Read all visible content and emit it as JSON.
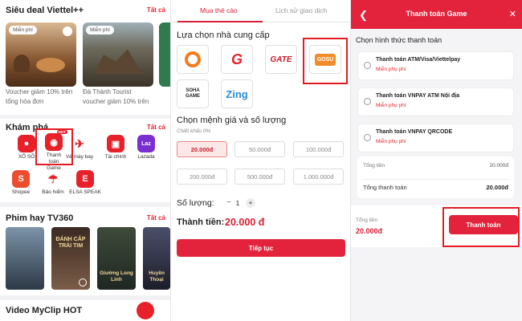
{
  "panel1": {
    "deals": {
      "title": "Siêu deal Viettel++",
      "see_all": "Tất cả",
      "items": [
        {
          "tag": "Miễn phí",
          "line1": "Voucher giảm 10% trên",
          "line2": "tổng hóa đơn"
        },
        {
          "tag": "Miễn phí",
          "line1": "Đà Thành Tourist",
          "line2": "voucher giảm 10% trên"
        }
      ]
    },
    "explore": {
      "title": "Khám phá",
      "see_all": "Tất cả",
      "apps": [
        {
          "label": "XỔ SỐ",
          "icon": "lottery-icon",
          "color": "#e8202a"
        },
        {
          "label": "Thanh toán Game",
          "icon": "gamepad-icon",
          "color": "#e8202a",
          "badge": "HOT"
        },
        {
          "label": "Vé máy bay",
          "icon": "plane-icon",
          "color": "#e8202a"
        },
        {
          "label": "Tài chính",
          "icon": "wallet-icon",
          "color": "#e8202a"
        },
        {
          "label": "Lazada",
          "icon": "lazada-icon",
          "color": "#7b2fd0"
        },
        {
          "label": "Shopee",
          "icon": "shopee-icon",
          "color": "#ee4d2d"
        },
        {
          "label": "Bảo hiểm",
          "icon": "umbrella-icon",
          "color": "#e8202a"
        },
        {
          "label": "ELSA SPEAK",
          "icon": "elsa-icon",
          "color": "#e8202a"
        }
      ]
    },
    "movies": {
      "title": "Phim hay TV360",
      "see_all": "Tất cả",
      "posters": [
        {
          "text": ""
        },
        {
          "text": "ĐÁNH CẮP TRÁI TIM"
        },
        {
          "text": "Giường Long Linh"
        },
        {
          "text": "Huyền Thoại"
        }
      ]
    },
    "clips": {
      "title": "Video MyClip HOT"
    }
  },
  "panel2": {
    "tabs": [
      "Mua thẻ cào",
      "Lịch sử giao dịch"
    ],
    "provider_title": "Lựa chọn nhà cung cấp",
    "providers": [
      {
        "name": "Funtap",
        "label": "funtap"
      },
      {
        "name": "Garena",
        "label": "G"
      },
      {
        "name": "Gate",
        "label": "GATE"
      },
      {
        "name": "Gosu",
        "label": "GOSU"
      },
      {
        "name": "Soha Game",
        "label": "SOHA GAME"
      },
      {
        "name": "Zing",
        "label": "Zing"
      }
    ],
    "price_title": "Chọn mệnh giá và số lượng",
    "discount": "Chiết khấu 0%",
    "prices": [
      "20.000đ",
      "50.000đ",
      "100.000đ",
      "200.000đ",
      "500.000đ",
      "1.000.000đ"
    ],
    "quantity_label": "Số lượng:",
    "quantity": "1",
    "minus": "−",
    "plus": "+",
    "total_label": "Thành tiền:",
    "total_value": "20.000 đ",
    "continue_label": "Tiếp tục"
  },
  "panel3": {
    "title": "Thanh toán Game",
    "back": "❮",
    "close": "✕",
    "method_title": "Chọn hình thức thanh toán",
    "methods": [
      {
        "name": "Thanh toán ATM/Visa/Viettelpay",
        "fee": "Miễn phụ phí"
      },
      {
        "name": "Thanh toán VNPAY ATM Nội địa",
        "fee": "Miễn phụ phí"
      },
      {
        "name": "Thanh toán VNPAY QRCODE",
        "fee": "Miễn phụ phí"
      }
    ],
    "subtotal_label": "Tổng tiền",
    "subtotal_value": "20.000đ",
    "total_label": "Tổng thanh toán",
    "total_value": "20.000đ",
    "footer_label": "Tổng tiền",
    "footer_value": "20.000đ",
    "pay_label": "Thanh toán"
  },
  "colors": {
    "accent": "#e3233b",
    "highlight": "#e51b24"
  }
}
